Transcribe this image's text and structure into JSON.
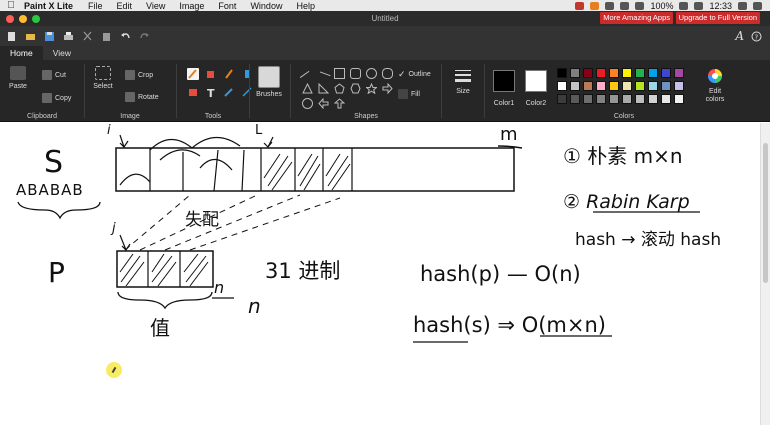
{
  "menubar": {
    "app_name": "Paint X Lite",
    "items": [
      "File",
      "Edit",
      "View",
      "Image",
      "Font",
      "Window",
      "Help"
    ],
    "battery": "100%",
    "clock": "12:33"
  },
  "window": {
    "title": "Untitled",
    "promo_more_apps": "More Amazing Apps",
    "promo_upgrade": "Upgrade to Full Version"
  },
  "tabs": [
    {
      "label": "Home",
      "active": true
    },
    {
      "label": "View",
      "active": false
    }
  ],
  "ribbon": {
    "clipboard": {
      "label": "Clipboard",
      "cut": "Cut",
      "paste": "Paste",
      "copy": "Copy"
    },
    "image": {
      "label": "Image",
      "select": "Select",
      "crop": "Crop",
      "rotate": "Rotate"
    },
    "tools": {
      "label": "Tools"
    },
    "brushes": {
      "label": "Brushes"
    },
    "shapes": {
      "label": "Shapes",
      "outline": "Outline",
      "fill": "Fill"
    },
    "size": {
      "label": "Size"
    },
    "colors": {
      "label": "Colors",
      "color1": "Color1",
      "color2": "Color2",
      "edit": "Edit colors",
      "color1_value": "#000000",
      "color2_value": "#ffffff",
      "swatches": [
        "#000000",
        "#7f7f7f",
        "#880015",
        "#ed1c24",
        "#ff7f27",
        "#fff200",
        "#22b14c",
        "#00a2e8",
        "#3f48cc",
        "#a349a4",
        "#ffffff",
        "#c3c3c3",
        "#b97a57",
        "#ffaec9",
        "#ffc90e",
        "#efe4b0",
        "#b5e61d",
        "#99d9ea",
        "#7092be",
        "#c8bfe7",
        "#3c3c3c",
        "#5a5a5a",
        "#6e6e6e",
        "#828282",
        "#969696",
        "#aaaaaa",
        "#bebebe",
        "#d2d2d2",
        "#e6e6e6",
        "#f0f0f0"
      ]
    }
  },
  "canvas": {
    "S": "S",
    "s_string": "ABABAB",
    "i_label": "i",
    "L_label": "L",
    "j_label": "j",
    "m_label": "m",
    "P": "P",
    "n_under": "n",
    "n_side": "n",
    "match_label": "失配",
    "value_label": "值",
    "base31": "31 进制",
    "note1": "① 朴素 m×n",
    "note2": "② Rabin Karp",
    "note3": "hash → 滚动 hash",
    "eq1": "hash(p) — O(n)",
    "eq2": "hash(s) ⇒ O(m×n)"
  }
}
